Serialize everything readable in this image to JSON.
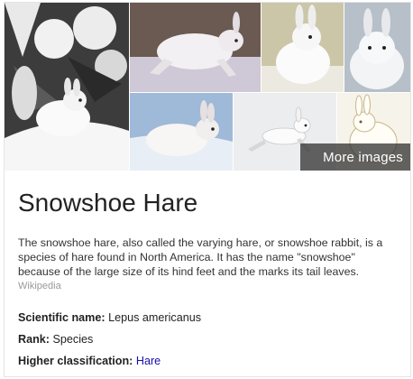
{
  "gallery": {
    "images": [
      {
        "name": "snowshoe-hare-tree-image"
      },
      {
        "name": "snowshoe-hare-running-image"
      },
      {
        "name": "snowshoe-hare-sitting-image"
      },
      {
        "name": "snowshoe-hare-closeup-image"
      },
      {
        "name": "snowshoe-hare-snow-image"
      },
      {
        "name": "snowshoe-hare-leaping-image"
      },
      {
        "name": "snowshoe-hare-drawing-image"
      }
    ],
    "more_images_label": "More images"
  },
  "entity": {
    "title": "Snowshoe Hare",
    "description": "The snowshoe hare, also called the varying hare, or snowshoe rabbit, is a species of hare found in North America. It has the name \"snowshoe\" because of the large size of its hind feet and the marks its tail leaves.",
    "source": "Wikipedia"
  },
  "facts": [
    {
      "label": "Scientific name:",
      "value": "Lepus americanus"
    },
    {
      "label": "Rank:",
      "value": "Species"
    },
    {
      "label": "Higher classification:",
      "value": "Hare"
    }
  ]
}
